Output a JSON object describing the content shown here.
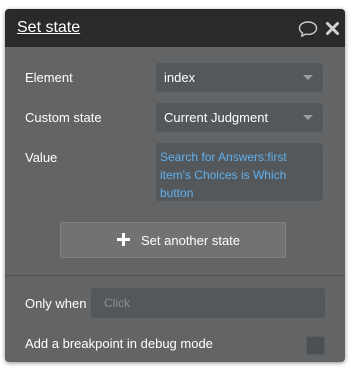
{
  "header": {
    "title": "Set state",
    "comment_icon": "speech-bubble-icon",
    "close_icon": "close-x-icon"
  },
  "fields": {
    "element": {
      "label": "Element",
      "value": "index"
    },
    "custom_state": {
      "label": "Custom state",
      "value": "Current Judgment"
    },
    "value": {
      "label": "Value",
      "expression": "Search for Answers:first item's Choices is Which button"
    }
  },
  "actions": {
    "set_another_state_label": "Set another state",
    "plus_icon": "plus-icon"
  },
  "conditions": {
    "only_when_label": "Only when",
    "only_when_placeholder": "Click",
    "breakpoint_label": "Add a breakpoint in debug mode",
    "breakpoint_checked": false
  },
  "colors": {
    "panel_bg": "#626466",
    "header_bg": "#282a2c",
    "field_bg": "#55585b",
    "expression_text": "#5fb0ef"
  }
}
